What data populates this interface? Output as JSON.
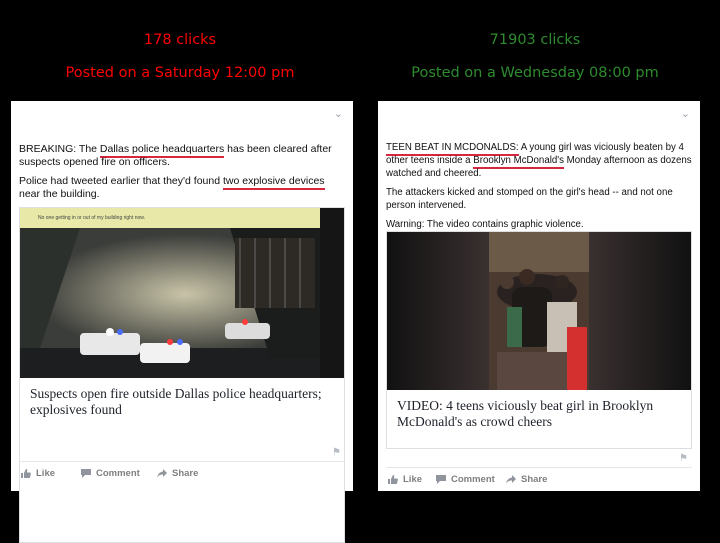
{
  "left": {
    "clicks": "178 clicks",
    "posted": "Posted on a Saturday 12:00 pm",
    "stat_color": "#ff0000",
    "p1": {
      "pre": "BREAKING: The ",
      "u": "Dallas police headquarters",
      "post": " has been cleared after suspects opened fire on officers."
    },
    "p2": {
      "pre": "Police had tweeted earlier that they'd found ",
      "u": "two explosive devices",
      "post": " near the building."
    },
    "tweet_overlay": "No one getting in or out of my building right now.",
    "headline": "Suspects open fire outside Dallas police headquarters; explosives found"
  },
  "right": {
    "clicks": "71903 clicks",
    "posted": "Posted on a Wednesday 08:00 pm",
    "stat_color": "#2e8b2e",
    "p1": {
      "u1": "TEEN BEAT IN MCDONALDS:",
      "mid": " A young girl was viciously beaten by 4 other teens inside a ",
      "u2": "Brooklyn McDonald's",
      "post": " Monday afternoon as dozens watched and cheered."
    },
    "p2": "The attackers kicked and stomped on the girl's head -- and not one person intervened.",
    "p3": "Warning: The video contains graphic violence.",
    "headline": "VIDEO: 4 teens viciously beat girl in Brooklyn McDonald's as crowd cheers"
  },
  "actions": {
    "like": "Like",
    "comment": "Comment",
    "share": "Share"
  },
  "icons": [
    "chevron-down-icon",
    "flag-icon",
    "like-icon",
    "comment-icon",
    "share-icon"
  ]
}
